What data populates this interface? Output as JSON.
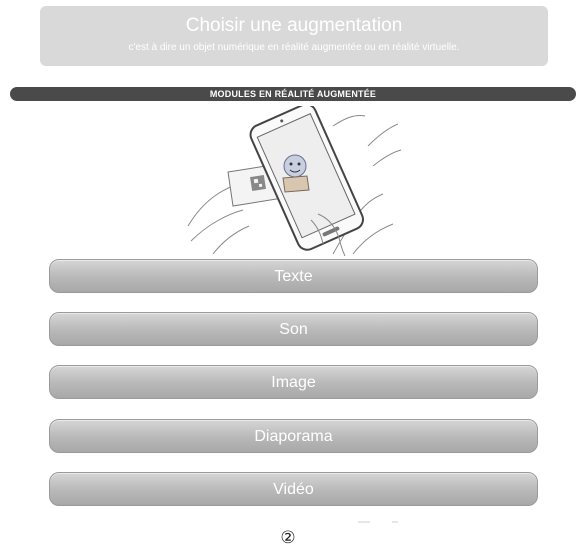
{
  "header": {
    "title": "Choisir une augmentation",
    "subtitle": "c'est à dire un objet numérique en réalité augmentée ou en réalité virtuelle."
  },
  "section": {
    "label": "MODULES EN RÉALITÉ AUGMENTÉE"
  },
  "illustration": {
    "icon": "phone-scanning-qr-illustration"
  },
  "modules": [
    {
      "label": "Texte"
    },
    {
      "label": "Son"
    },
    {
      "label": "Image"
    },
    {
      "label": "Diaporama"
    },
    {
      "label": "Vidéo"
    }
  ],
  "page_number": "②",
  "colors": {
    "header_bg": "#d9d9d9",
    "section_bar": "#4a4a4a",
    "button_top": "#d6d6d6",
    "button_bottom": "#a8a8a8",
    "text_light": "#ffffff"
  }
}
